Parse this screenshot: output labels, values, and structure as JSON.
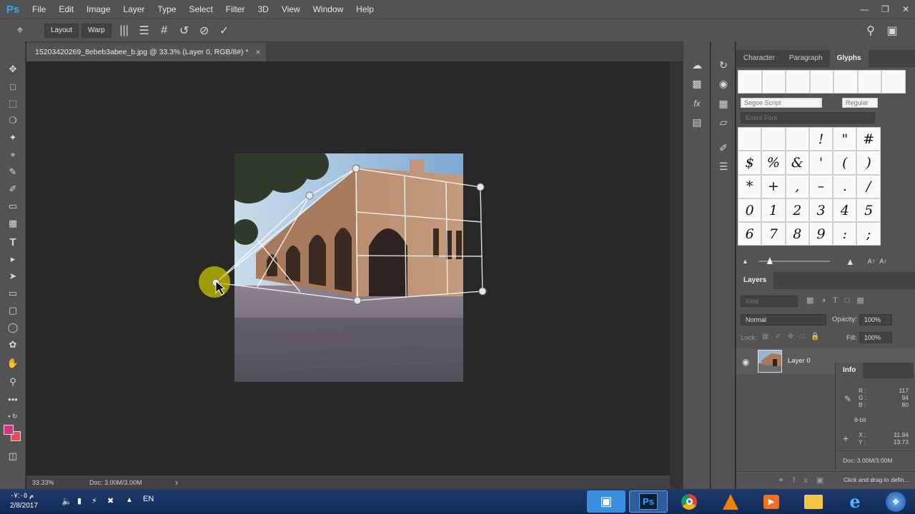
{
  "app": {
    "logo": "Ps",
    "menu": [
      "File",
      "Edit",
      "Image",
      "Layer",
      "Type",
      "Select",
      "Filter",
      "3D",
      "View",
      "Window",
      "Help"
    ],
    "window_controls": [
      "minimize-icon",
      "restore-icon",
      "close-icon"
    ]
  },
  "options_bar": {
    "layout_label": "Layout",
    "warp_label": "Warp"
  },
  "document": {
    "tab_title": "15203420269_8ebeb3abee_b.jpg @ 33.3% (Layer 0, RGB/8#) *",
    "close": "×"
  },
  "status_bar": {
    "zoom": "33.33%",
    "doc_size": "Doc: 3.00M/3.00M",
    "arrow": "›"
  },
  "character_panel": {
    "tabs": [
      "Character",
      "Paragraph",
      "Glyphs"
    ],
    "active_tab": "Glyphs",
    "font_family": "Segoe Script",
    "font_style": "Regular",
    "glyph_set": "Entire Font",
    "glyphs": [
      "",
      "",
      "",
      "!",
      "\"",
      "#",
      "$",
      "%",
      "&",
      "'",
      "(",
      ")",
      "*",
      "+",
      ",",
      "–",
      ".",
      "/",
      "0",
      "1",
      "2",
      "3",
      "4",
      "5",
      "6",
      "7",
      "8",
      "9",
      ":",
      ";"
    ]
  },
  "layers_panel": {
    "tab": "Layers",
    "filter_placeholder": "Kind",
    "blend_mode": "Normal",
    "opacity_label": "Opacity:",
    "opacity_value": "100%",
    "lock_label": "Lock:",
    "fill_label": "Fill:",
    "fill_value": "100%",
    "layers": [
      {
        "name": "Layer 0",
        "visible": true
      }
    ]
  },
  "info_panel": {
    "tab": "Info",
    "r_label": "R :",
    "r_value": "117",
    "g_label": "G :",
    "g_value": "94",
    "b_label": "B :",
    "b_value": "80",
    "bit_depth": "8-bit",
    "x_label": "X :",
    "x_value": "11.94",
    "y_label": "Y :",
    "y_value": "13.73",
    "doc_size": "Doc: 3.00M/3.00M",
    "hint": "Click and drag to defin..."
  },
  "taskbar": {
    "time": "م ٠٧:٠٥",
    "date": "2/8/2017",
    "language": "EN"
  },
  "colors": {
    "foreground": "#d63384",
    "background": "#e84a5f",
    "photoshop_blue": "#31a8ff"
  }
}
